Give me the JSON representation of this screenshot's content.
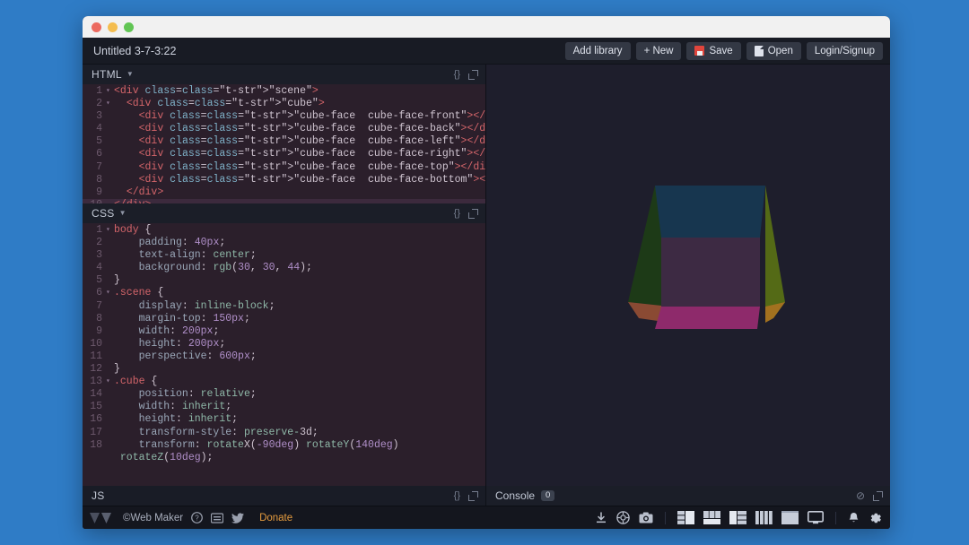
{
  "window": {
    "traffic_lights": [
      "close",
      "minimize",
      "maximize"
    ]
  },
  "appbar": {
    "doc_title": "Untitled 3-7-3:22",
    "buttons": [
      {
        "label": "Add library",
        "icon": null,
        "name": "add-library-button"
      },
      {
        "label": "+ New",
        "icon": null,
        "name": "new-button"
      },
      {
        "label": "Save",
        "icon": "floppy-disk-icon",
        "name": "save-button"
      },
      {
        "label": "Open",
        "icon": "document-icon",
        "name": "open-button"
      },
      {
        "label": "Login/Signup",
        "icon": null,
        "name": "login-signup-button"
      }
    ]
  },
  "panes": {
    "html": {
      "title": "HTML",
      "format_icon": "{}",
      "expand_icon": "expand-icon",
      "lines": [
        {
          "n": "1",
          "fold": "▾",
          "active": false
        },
        {
          "n": "2",
          "fold": "▾",
          "active": false
        },
        {
          "n": "3",
          "fold": "",
          "active": false
        },
        {
          "n": "4",
          "fold": "",
          "active": false
        },
        {
          "n": "5",
          "fold": "",
          "active": false
        },
        {
          "n": "6",
          "fold": "",
          "active": false
        },
        {
          "n": "7",
          "fold": "",
          "active": false
        },
        {
          "n": "8",
          "fold": "",
          "active": false
        },
        {
          "n": "9",
          "fold": "",
          "active": false
        },
        {
          "n": "10",
          "fold": "",
          "active": true
        }
      ],
      "code_text": [
        "<div class=\"scene\">",
        "  <div class=\"cube\">",
        "    <div class=\"cube-face  cube-face-front\"></div>",
        "    <div class=\"cube-face  cube-face-back\"></div>",
        "    <div class=\"cube-face  cube-face-left\"></div>",
        "    <div class=\"cube-face  cube-face-right\"></div>",
        "    <div class=\"cube-face  cube-face-top\"></div>",
        "    <div class=\"cube-face  cube-face-bottom\"></div>",
        "  </div>",
        "</div>"
      ]
    },
    "css": {
      "title": "CSS",
      "format_icon": "{}",
      "expand_icon": "expand-icon",
      "lines": [
        {
          "n": "1",
          "fold": "▾"
        },
        {
          "n": "2",
          "fold": ""
        },
        {
          "n": "3",
          "fold": ""
        },
        {
          "n": "4",
          "fold": ""
        },
        {
          "n": "5",
          "fold": ""
        },
        {
          "n": "6",
          "fold": "▾"
        },
        {
          "n": "7",
          "fold": ""
        },
        {
          "n": "8",
          "fold": ""
        },
        {
          "n": "9",
          "fold": ""
        },
        {
          "n": "10",
          "fold": ""
        },
        {
          "n": "11",
          "fold": ""
        },
        {
          "n": "12",
          "fold": ""
        },
        {
          "n": "13",
          "fold": "▾"
        },
        {
          "n": "14",
          "fold": ""
        },
        {
          "n": "15",
          "fold": ""
        },
        {
          "n": "16",
          "fold": ""
        },
        {
          "n": "17",
          "fold": ""
        },
        {
          "n": "18",
          "fold": ""
        },
        {
          "n": "",
          "fold": ""
        }
      ],
      "code_text": [
        "body {",
        "    padding: 40px;",
        "    text-align: center;",
        "    background: rgb(30, 30, 44);",
        "}",
        ".scene {",
        "    display: inline-block;",
        "    margin-top: 150px;",
        "    width: 200px;",
        "    height: 200px;",
        "    perspective: 600px;",
        "}",
        ".cube {",
        "    position: relative;",
        "    width: inherit;",
        "    height: inherit;",
        "    transform-style: preserve-3d;",
        "    transform: rotateX(-90deg) rotateY(140deg)",
        " rotateZ(10deg);"
      ]
    },
    "js": {
      "title": "JS",
      "format_icon": "{}",
      "expand_icon": "expand-icon"
    }
  },
  "console": {
    "label": "Console",
    "count": "0",
    "clear_icon": "no-entry-icon",
    "expand_icon": "expand-icon"
  },
  "preview": {
    "background": "#1e1e2c",
    "cube": {
      "face_top_color": "#17364f",
      "face_left_color": "#1d3a17",
      "face_right_color": "#546a16",
      "face_front_color": "#3d2a43",
      "face_bottom_color": "#8e2a6b",
      "corner_left_color": "#8a4a33",
      "corner_right_color": "#a2711f"
    }
  },
  "footer": {
    "logo": "web-maker-logo",
    "brand": "©Web Maker",
    "icons": [
      {
        "name": "help-icon",
        "glyph": "?"
      },
      {
        "name": "keyboard-shortcuts-icon",
        "glyph": "⌨"
      },
      {
        "name": "twitter-icon",
        "glyph": "twitter"
      }
    ],
    "donate_label": "Donate",
    "right_icons": [
      {
        "name": "download-icon"
      },
      {
        "name": "detached-preview-icon"
      },
      {
        "name": "screenshot-icon"
      }
    ],
    "layout_modes": [
      {
        "name": "layout-mode-1"
      },
      {
        "name": "layout-mode-2"
      },
      {
        "name": "layout-mode-3"
      },
      {
        "name": "layout-mode-4"
      },
      {
        "name": "layout-mode-5"
      },
      {
        "name": "layout-mode-preview-only"
      }
    ],
    "end_icons": [
      {
        "name": "notifications-bell-icon"
      },
      {
        "name": "settings-gear-icon"
      }
    ]
  },
  "colors": {
    "desktop": "#2f7cc6",
    "window_chrome": "#f1f1f1",
    "app_bar": "#181b24",
    "editor_bg": "#2b1f2b",
    "active_line": "#3c2a3d",
    "accent_orange": "#e49b3f",
    "save_red": "#e0453c"
  }
}
